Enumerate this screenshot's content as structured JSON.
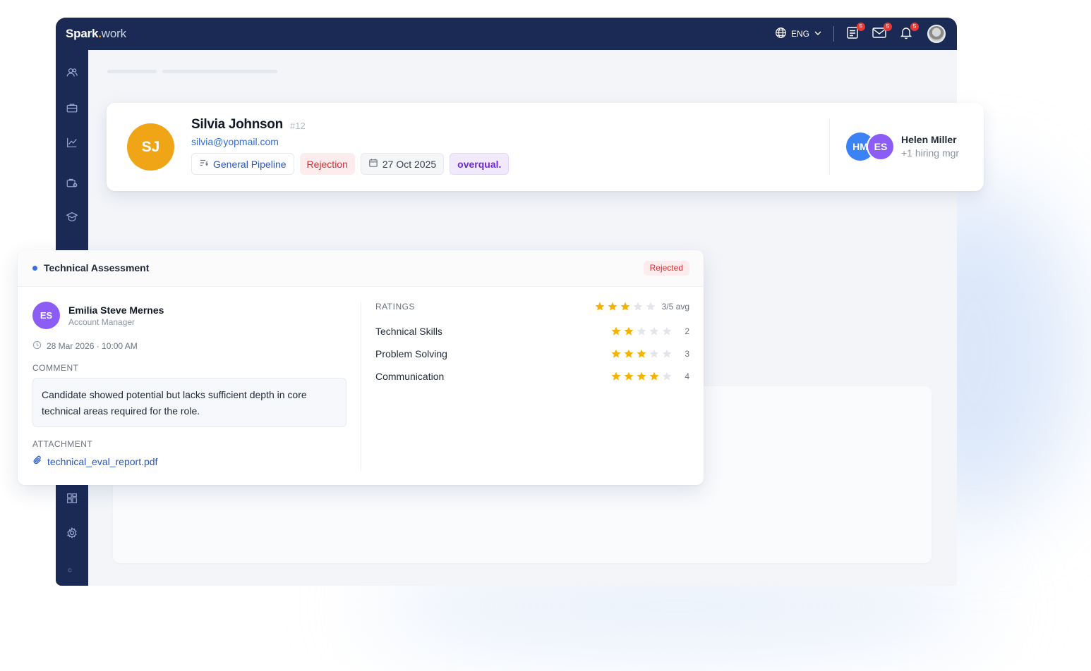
{
  "app": {
    "logo_bold": "Spark",
    "logo_dot": ".",
    "logo_thin": "work",
    "language": "ENG",
    "notifications": {
      "tasks": "5",
      "messages": "5",
      "alerts": "5"
    },
    "footer_mark": "©"
  },
  "candidate": {
    "initials": "SJ",
    "name": "Silvia Johnson",
    "id": "#12",
    "email": "silvia@yopmail.com",
    "pipeline": "General Pipeline",
    "stage": "Rejection",
    "date": "27 Oct 2025",
    "tag": "overqual.",
    "hiring_manager": {
      "initials_1": "HM",
      "initials_2": "ES",
      "name": "Helen Miller",
      "more": "+1 hiring mgr"
    }
  },
  "assessment": {
    "title": "Technical Assessment",
    "status": "Rejected",
    "reviewer": {
      "initials": "ES",
      "name": "Emilia Steve Mernes",
      "role": "Account Manager",
      "datetime": "28 Mar 2026 · 10:00 AM"
    },
    "comment_label": "COMMENT",
    "comment": "Candidate showed potential but lacks sufficient depth in core technical areas required for the role.",
    "attachment_label": "ATTACHMENT",
    "attachment": "technical_eval_report.pdf",
    "ratings_label": "RATINGS",
    "average_text": "3/5 avg",
    "average_stars": 3,
    "max_stars": 5,
    "ratings": [
      {
        "name": "Technical Skills",
        "score": 2,
        "score_text": "2"
      },
      {
        "name": "Problem Solving",
        "score": 3,
        "score_text": "3"
      },
      {
        "name": "Communication",
        "score": 4,
        "score_text": "4"
      }
    ]
  },
  "colors": {
    "topbar": "#1b2a55",
    "star_on": "#f5b301",
    "star_off": "#e3e6eb",
    "link": "#2557c7",
    "reject": "#d62e2e"
  }
}
